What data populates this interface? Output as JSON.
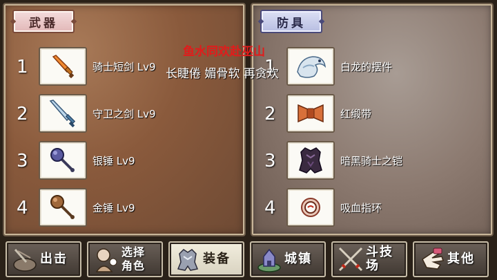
{
  "weapons": {
    "title": "武器",
    "items": [
      {
        "num": "1",
        "name": "骑士短剑 Lv9",
        "icon": "short-sword-icon"
      },
      {
        "num": "2",
        "name": "守卫之剑 Lv9",
        "icon": "guardian-sword-icon"
      },
      {
        "num": "3",
        "name": "银锤 Lv9",
        "icon": "silver-mace-icon"
      },
      {
        "num": "4",
        "name": "金锤 Lv9",
        "icon": "gold-mace-icon"
      }
    ]
  },
  "armor": {
    "title": "防具",
    "items": [
      {
        "num": "1",
        "name": "白龙的摆件",
        "icon": "white-dragon-ornament-icon"
      },
      {
        "num": "2",
        "name": "红缎带",
        "icon": "red-ribbon-icon"
      },
      {
        "num": "3",
        "name": "暗黑骑士之铠",
        "icon": "dark-knight-armor-icon"
      },
      {
        "num": "4",
        "name": "吸血指环",
        "icon": "vampire-ring-icon"
      }
    ]
  },
  "overlay": {
    "line1": "鱼水同欢赴巫山",
    "line2": "长睫倦 媚骨软 再贪欢"
  },
  "nav": {
    "sortie": "出击",
    "select_line1": "选择",
    "select_line2": "角色",
    "equip": "装备",
    "town": "城镇",
    "arena": "斗技场",
    "other": "其他"
  },
  "colors": {
    "overlay_red": "#e21b1b",
    "weapons_panel": "#8a5a3c",
    "armor_panel": "#8c7a70"
  }
}
